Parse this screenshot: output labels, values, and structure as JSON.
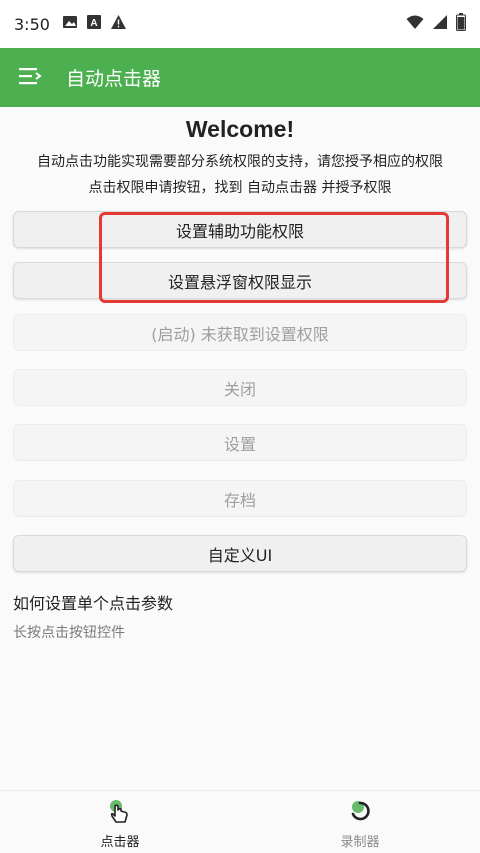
{
  "status_bar": {
    "time": "3:50",
    "left_icons": [
      "image-icon",
      "font-icon",
      "warning-icon"
    ],
    "right_icons": [
      "wifi-icon",
      "signal-icon",
      "battery-icon"
    ]
  },
  "app_bar": {
    "title": "自动点击器",
    "color": "#4caf50"
  },
  "main": {
    "welcome": "Welcome!",
    "intro_line1": "自动点击功能实现需要部分系统权限的支持，请您授予相应的权限",
    "intro_line2": "点击权限申请按钮，找到 自动点击器 并授予权限",
    "buttons": [
      {
        "label": "设置辅助功能权限",
        "enabled": true
      },
      {
        "label": "设置悬浮窗权限显示",
        "enabled": true
      },
      {
        "label": "(启动) 未获取到设置权限",
        "enabled": false
      },
      {
        "label": "关闭",
        "enabled": false
      },
      {
        "label": "设置",
        "enabled": false
      },
      {
        "label": "存档",
        "enabled": false
      },
      {
        "label": "自定义UI",
        "enabled": true
      }
    ],
    "help_title": "如何设置单个点击参数",
    "help_text": "长按点击按钮控件"
  },
  "bottom_nav": {
    "items": [
      {
        "label": "点击器",
        "icon": "tap-hand-icon",
        "active": true
      },
      {
        "label": "录制器",
        "icon": "record-icon",
        "active": false
      }
    ]
  },
  "colors": {
    "primary": "#4caf50",
    "highlight": "#e53935"
  }
}
